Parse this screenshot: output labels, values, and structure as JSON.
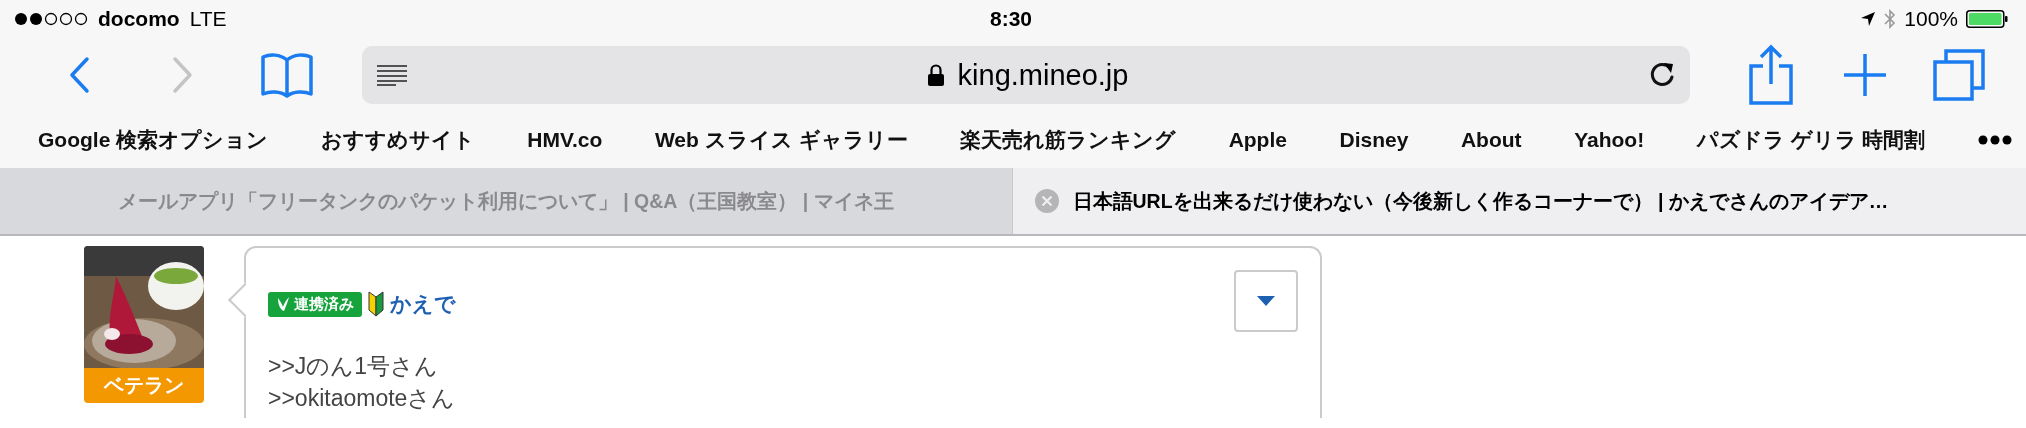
{
  "status_bar": {
    "carrier": "docomo",
    "network": "LTE",
    "time": "8:30",
    "battery": "100%"
  },
  "toolbar": {
    "url": "king.mineo.jp"
  },
  "bookmarks": [
    "Google 検索オプション",
    "おすすめサイト",
    "HMV.co",
    "Web スライス ギャラリー",
    "楽天売れ筋ランキング",
    "Apple",
    "Disney",
    "About",
    "Yahoo!",
    "パズドラ ゲリラ 時間割"
  ],
  "tabs": [
    {
      "title": "メールアプリ「フリータンクのパケット利用について」 | Q&A（王国教室） | マイネ王",
      "selected": false
    },
    {
      "title": "日本語URLを出来るだけ使わない（今後新しく作るコーナーで） | かえでさんのアイデア…",
      "selected": true
    }
  ],
  "post": {
    "rank": "ベテラン",
    "badge": "連携済み",
    "author": "かえで",
    "lines": [
      ">>Jのん1号さん",
      ">>okitaomoteさん"
    ]
  }
}
